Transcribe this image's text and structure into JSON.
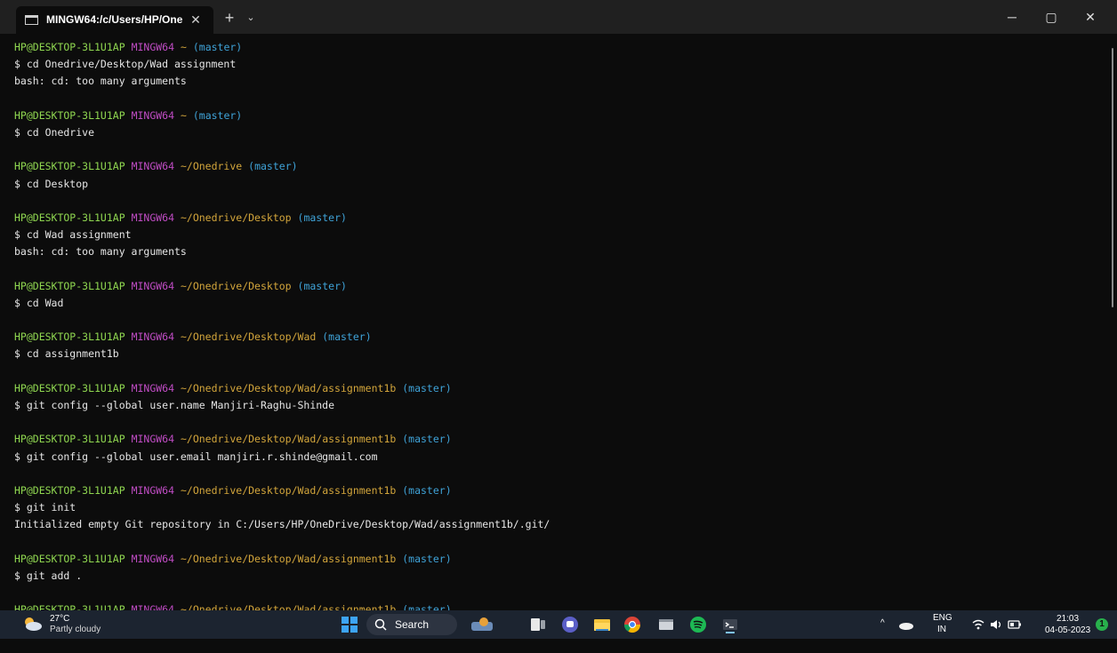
{
  "window": {
    "tab_title": "MINGW64:/c/Users/HP/One",
    "tab_close": "✕",
    "new_tab": "+",
    "dropdown": "⌄",
    "minimize": "─",
    "maximize": "▢",
    "close": "✕"
  },
  "terminal": {
    "prompt": {
      "user": "HP@DESKTOP-3L1U1AP",
      "host": "MINGW64",
      "branch": "(master)"
    },
    "entries": [
      {
        "path": "~",
        "command": "$ cd Onedrive/Desktop/Wad assignment",
        "output": [
          "bash: cd: too many arguments"
        ]
      },
      {
        "path": "~",
        "command": "$ cd Onedrive",
        "output": []
      },
      {
        "path": "~/Onedrive",
        "command": "$ cd Desktop",
        "output": []
      },
      {
        "path": "~/Onedrive/Desktop",
        "command": "$ cd Wad assignment",
        "output": [
          "bash: cd: too many arguments"
        ]
      },
      {
        "path": "~/Onedrive/Desktop",
        "command": "$ cd Wad",
        "output": []
      },
      {
        "path": "~/Onedrive/Desktop/Wad",
        "command": "$ cd assignment1b",
        "output": []
      },
      {
        "path": "~/Onedrive/Desktop/Wad/assignment1b",
        "command": "$ git config --global user.name Manjiri-Raghu-Shinde",
        "output": []
      },
      {
        "path": "~/Onedrive/Desktop/Wad/assignment1b",
        "command": "$ git config --global user.email manjiri.r.shinde@gmail.com",
        "output": []
      },
      {
        "path": "~/Onedrive/Desktop/Wad/assignment1b",
        "command": "$ git init",
        "output": [
          "Initialized empty Git repository in C:/Users/HP/OneDrive/Desktop/Wad/assignment1b/.git/"
        ]
      },
      {
        "path": "~/Onedrive/Desktop/Wad/assignment1b",
        "command": "$ git add .",
        "output": []
      },
      {
        "path": "~/Onedrive/Desktop/Wad/assignment1b",
        "command": "",
        "output": []
      }
    ]
  },
  "taskbar": {
    "weather_temp": "27°C",
    "weather_desc": "Partly cloudy",
    "search_label": "Search",
    "lang_top": "ENG",
    "lang_bottom": "IN",
    "time": "21:03",
    "date": "04-05-2023",
    "notification_count": "1",
    "tray_chevron": "^"
  },
  "colors": {
    "user": "#8fd650",
    "host": "#c04cc4",
    "path": "#d2a53b",
    "branch": "#3fa3d8"
  }
}
